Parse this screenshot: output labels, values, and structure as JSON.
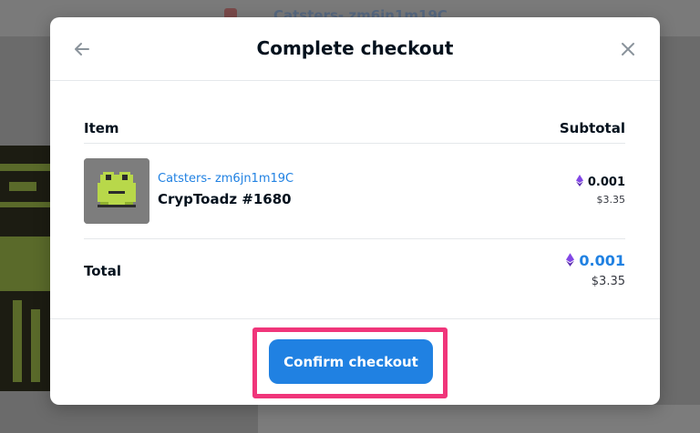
{
  "background": {
    "title_partial": "Catsters- zm6jn1m19C"
  },
  "modal": {
    "title": "Complete checkout",
    "back_icon": "arrow-left-icon",
    "close_icon": "close-icon"
  },
  "table": {
    "headers": [
      "Item",
      "Subtotal"
    ],
    "item": {
      "collection": "Catsters- zm6jn1m19C",
      "name": "CrypToadz #1680",
      "price_eth": "0.001",
      "price_usd": "$3.35"
    },
    "total": {
      "label": "Total",
      "price_eth": "0.001",
      "price_usd": "$3.35"
    }
  },
  "actions": {
    "confirm_label": "Confirm checkout"
  },
  "colors": {
    "accent": "#2081e2",
    "highlight": "#f0357a",
    "eth": "#8247e5"
  }
}
